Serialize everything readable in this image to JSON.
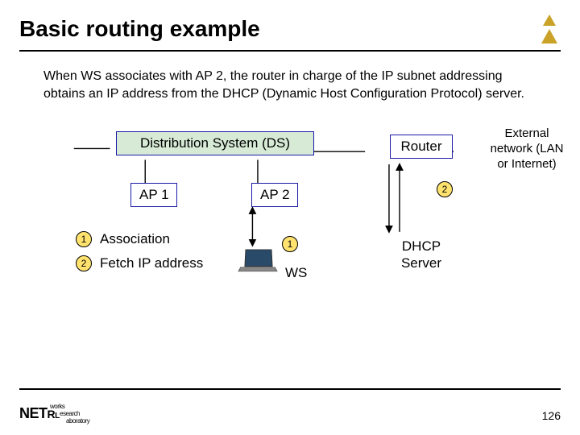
{
  "title": "Basic routing example",
  "body": "When WS associates with AP 2, the router in charge of the IP subnet addressing obtains an IP address from the DHCP (Dynamic Host Configuration Protocol) server.",
  "diagram": {
    "ds": "Distribution System (DS)",
    "ap1": "AP 1",
    "ap2": "AP 2",
    "router": "Router",
    "external": "External network (LAN or Internet)",
    "dhcp": "DHCP Server",
    "ws": "WS",
    "step1_num": "1",
    "step1_label": "Association",
    "step2_num": "2",
    "step2_label": "Fetch IP address",
    "marker_ws": "1",
    "marker_router": "2"
  },
  "footer": {
    "logo_main": "NET",
    "logo_sub1": "works",
    "logo_sub2": "esearch",
    "logo_sub3": "aboratory",
    "logo_R": "R",
    "logo_L": "L",
    "page": "126"
  }
}
